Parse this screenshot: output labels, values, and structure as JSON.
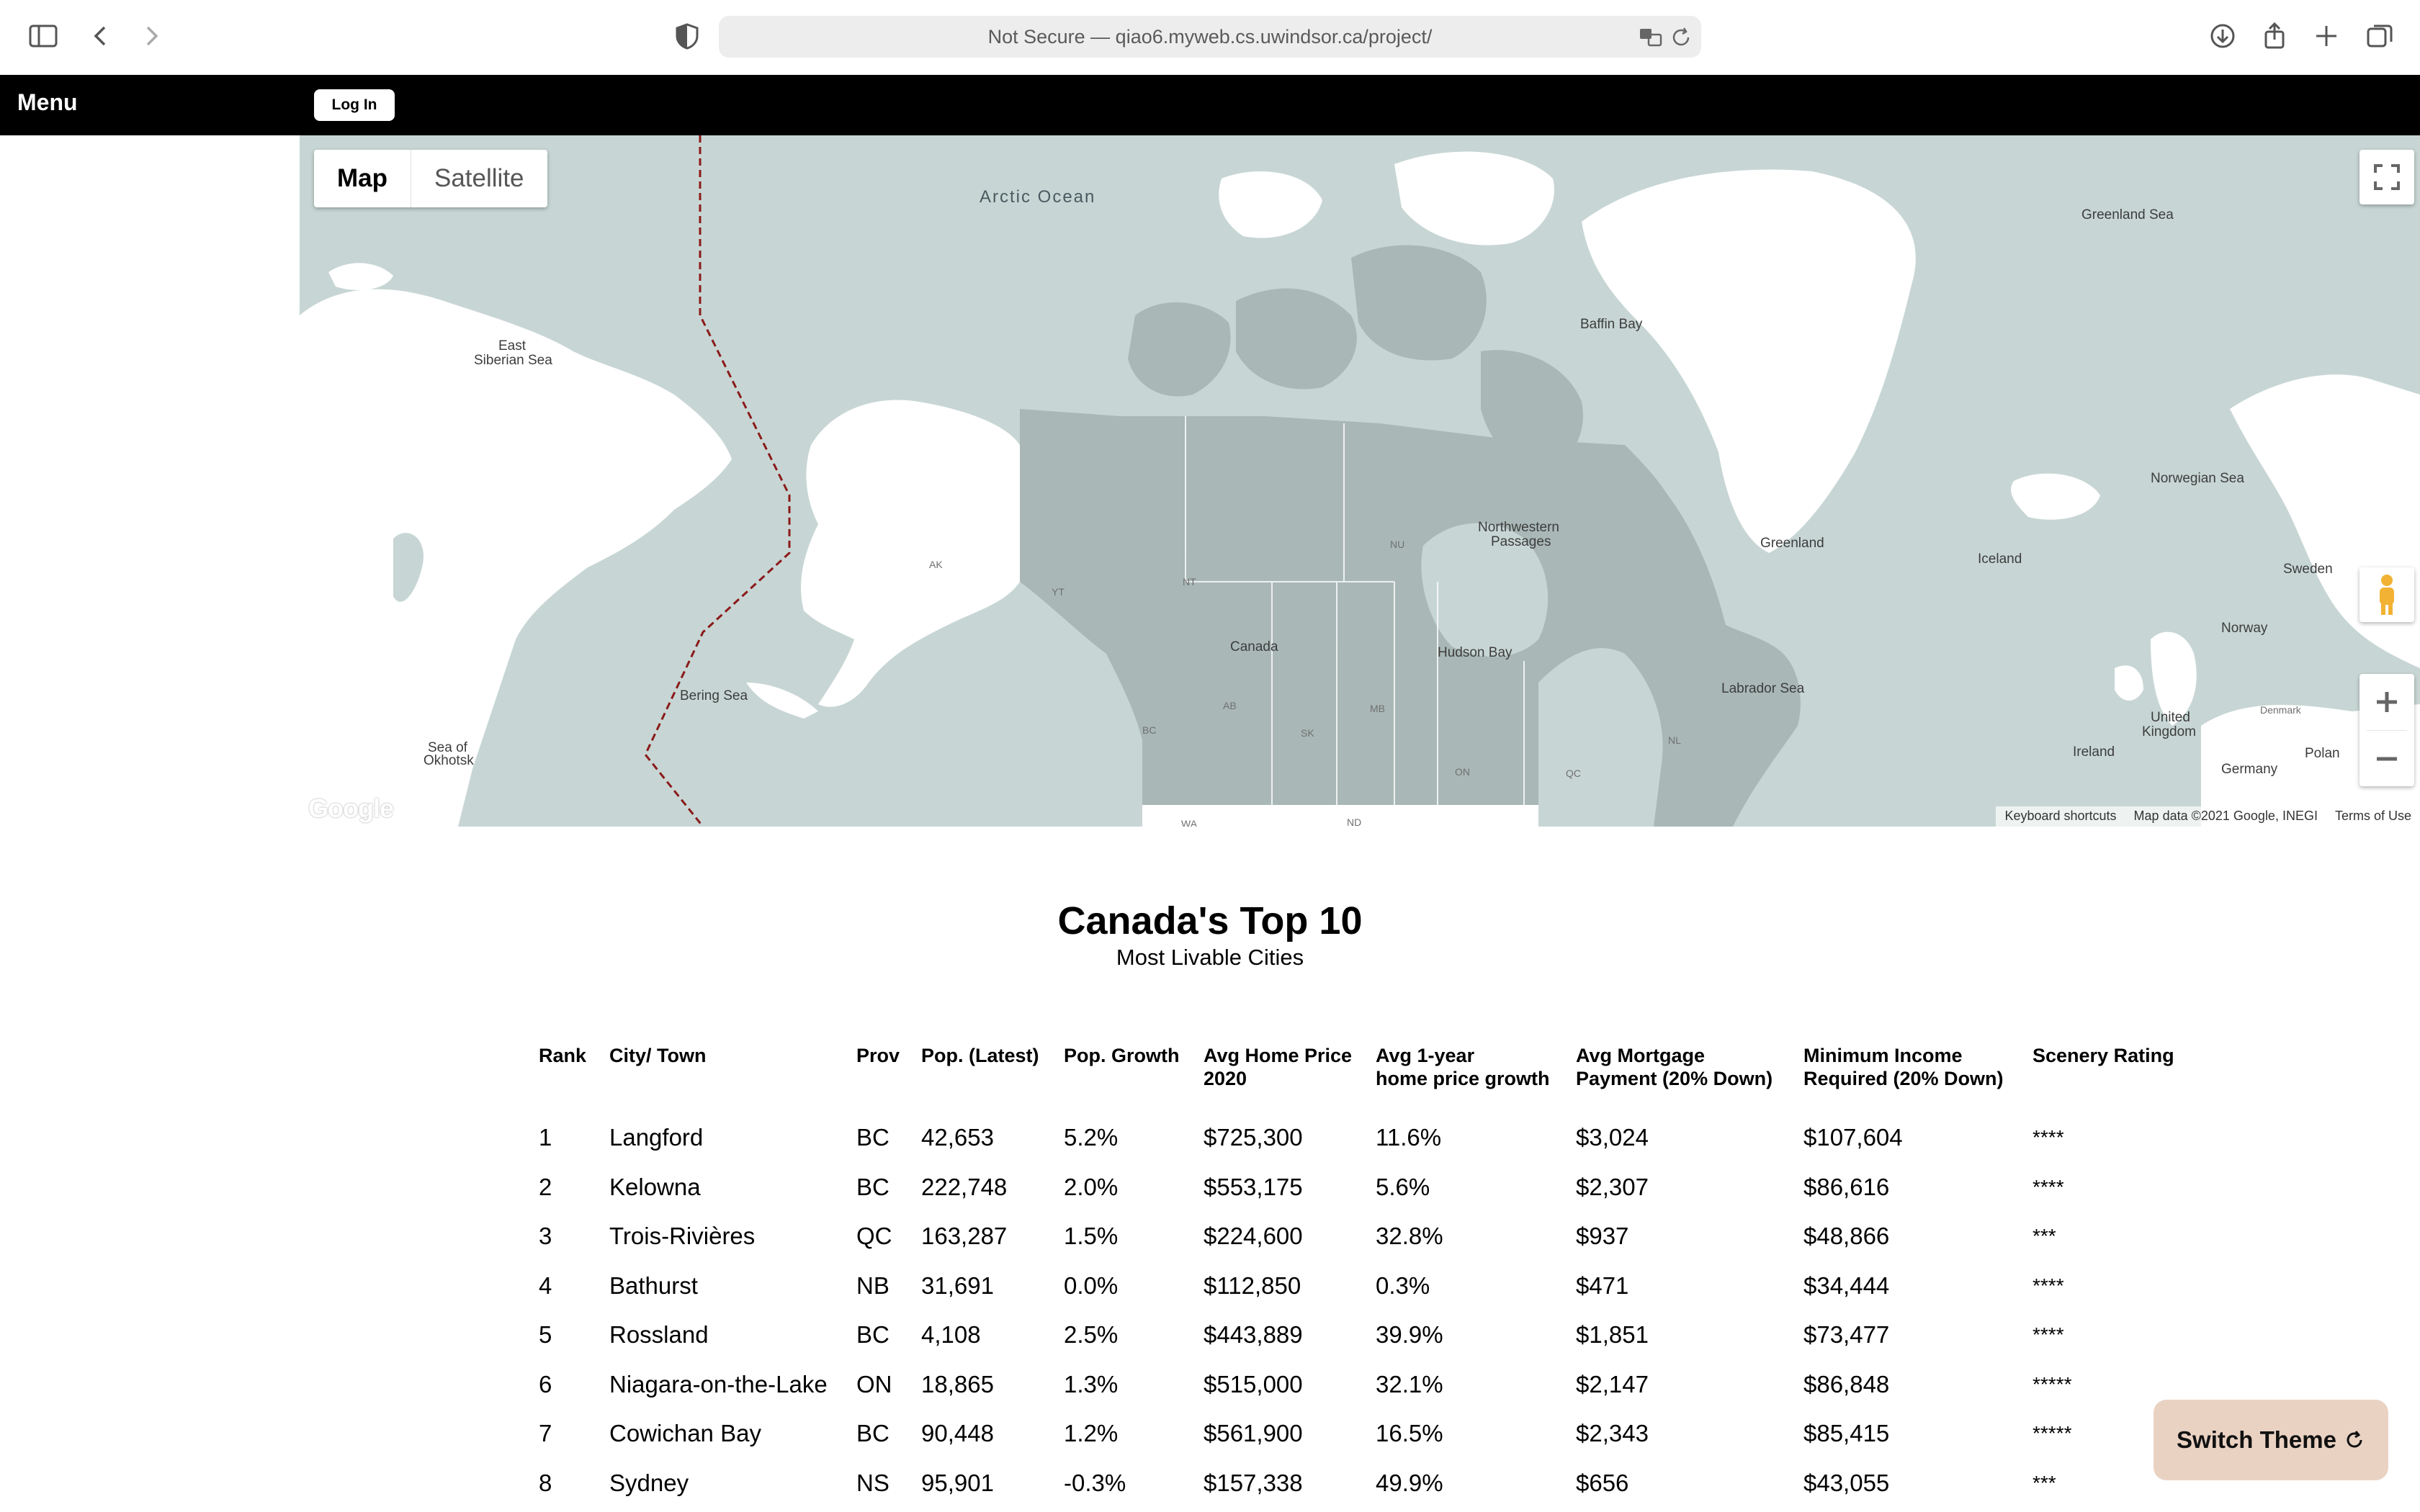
{
  "browser": {
    "url": "Not Secure — qiao6.myweb.cs.uwindsor.ca/project/"
  },
  "navbar": {
    "menu_label": "Menu",
    "login_label": "Log In"
  },
  "map": {
    "type_map": "Map",
    "type_satellite": "Satellite",
    "labels": {
      "arctic_ocean": "Arctic Ocean",
      "east_siberian_1": "East",
      "east_siberian_2": "Siberian Sea",
      "baffin_bay": "Baffin Bay",
      "greenland_sea": "Greenland Sea",
      "norwegian_sea": "Norwegian Sea",
      "greenland": "Greenland",
      "iceland": "Iceland",
      "nw_passages_1": "Northwestern",
      "nw_passages_2": "Passages",
      "hudson_bay": "Hudson Bay",
      "labrador_sea": "Labrador Sea",
      "bering_sea": "Bering Sea",
      "okhotsk_1": "Sea of",
      "okhotsk_2": "Okhotsk",
      "canada": "Canada",
      "sweden": "Sweden",
      "norway": "Norway",
      "denmark": "Denmark",
      "uk_1": "United",
      "uk_2": "Kingdom",
      "ireland": "Ireland",
      "germany": "Germany",
      "poland": "Polan",
      "ak": "AK",
      "yt": "YT",
      "nt": "NT",
      "nu": "NU",
      "bc": "BC",
      "ab": "AB",
      "sk": "SK",
      "mb": "MB",
      "on": "ON",
      "qc": "QC",
      "nl": "NL",
      "wa": "WA",
      "nd": "ND"
    },
    "footer": {
      "shortcuts": "Keyboard shortcuts",
      "data": "Map data ©2021 Google, INEGI",
      "terms": "Terms of Use"
    },
    "logo": "Google"
  },
  "heading": {
    "title": "Canada's Top 10",
    "subtitle": "Most Livable Cities"
  },
  "table": {
    "headers": [
      [
        "Rank"
      ],
      [
        "City/ Town"
      ],
      [
        "Prov"
      ],
      [
        "Pop. (Latest)"
      ],
      [
        "Pop. Growth"
      ],
      [
        "Avg Home Price",
        "2020"
      ],
      [
        "Avg 1-year",
        "home price growth"
      ],
      [
        "Avg Mortgage",
        "Payment (20% Down)"
      ],
      [
        "Minimum Income",
        "Required (20% Down)"
      ],
      [
        "Scenery Rating"
      ]
    ],
    "rows": [
      [
        "1",
        "Langford",
        "BC",
        "42,653",
        "5.2%",
        "$725,300",
        "11.6%",
        "$3,024",
        "$107,604",
        "****"
      ],
      [
        "2",
        "Kelowna",
        "BC",
        "222,748",
        "2.0%",
        "$553,175",
        "5.6%",
        "$2,307",
        "$86,616",
        "****"
      ],
      [
        "3",
        "Trois-Rivières",
        "QC",
        "163,287",
        "1.5%",
        "$224,600",
        "32.8%",
        "$937",
        "$48,866",
        "***"
      ],
      [
        "4",
        "Bathurst",
        "NB",
        "31,691",
        "0.0%",
        "$112,850",
        "0.3%",
        "$471",
        "$34,444",
        "****"
      ],
      [
        "5",
        "Rossland",
        "BC",
        "4,108",
        "2.5%",
        "$443,889",
        "39.9%",
        "$1,851",
        "$73,477",
        "****"
      ],
      [
        "6",
        "Niagara-on-the-Lake",
        "ON",
        "18,865",
        "1.3%",
        "$515,000",
        "32.1%",
        "$2,147",
        "$86,848",
        "*****"
      ],
      [
        "7",
        "Cowichan Bay",
        "BC",
        "90,448",
        "1.2%",
        "$561,900",
        "16.5%",
        "$2,343",
        "$85,415",
        "*****"
      ],
      [
        "8",
        "Sydney",
        "NS",
        "95,901",
        "-0.3%",
        "$157,338",
        "49.9%",
        "$656",
        "$43,055",
        "***"
      ]
    ]
  },
  "switch_theme": {
    "label": "Switch Theme"
  }
}
